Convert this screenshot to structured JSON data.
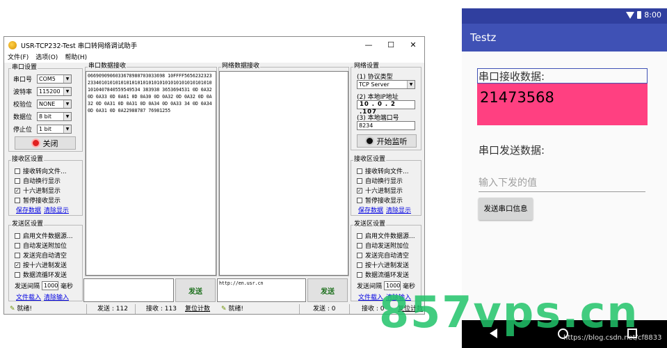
{
  "window": {
    "title": "USR-TCP232-Test 串口转网络调试助手",
    "controls": {
      "minimize": "—",
      "maximize": "☐",
      "close": "✕"
    }
  },
  "menu": [
    "文件(F)",
    "选项(O)",
    "帮助(H)"
  ],
  "serial_settings": {
    "title": "串口设置",
    "port_label": "串口号",
    "port_value": "COM5",
    "baud_label": "波特率",
    "baud_value": "115200",
    "parity_label": "校验位",
    "parity_value": "NONE",
    "databits_label": "数据位",
    "databits_value": "8 bit",
    "stopbits_label": "停止位",
    "stopbits_value": "1 bit",
    "close_button": "关闭"
  },
  "left_recv_settings": {
    "title": "接收区设置",
    "options": [
      "接收转向文件...",
      "自动换行显示",
      "十六进制显示",
      "暂停接收显示"
    ],
    "checked": [
      false,
      false,
      true,
      false
    ],
    "save_link": "保存数据",
    "clear_link": "清除显示"
  },
  "left_send_settings": {
    "title": "发送区设置",
    "options": [
      "启用文件数据源...",
      "自动发送附加位",
      "发送完自动清空",
      "按十六进制发送",
      "数据流循环发送"
    ],
    "checked": [
      false,
      false,
      false,
      true,
      false
    ],
    "interval_label": "发送间隔",
    "interval_value": "1000",
    "interval_unit": "毫秒",
    "load_link": "文件载入",
    "clear_link": "清除输入"
  },
  "serial_recv": {
    "title": "串口数据接收",
    "text": "0669090906033678980703033698 10FFFF56562323232334010101010101010101010101010101010101010101010407840559549534 383938 3653694531 0D 0A32 0D 0A33 0D 0A61 0D 0A30 0D 0A32 0D 0A32 0D 0A32 0D 0A31 0D 0A31 0D 0A34 0D 0A33 34 0D 0A34 0D 0A31 0D 0A22988787 76981255"
  },
  "net_recv": {
    "title": "网络数据接收"
  },
  "net_settings": {
    "title": "网络设置",
    "protocol_label": "(1) 协议类型",
    "protocol_value": "TCP Server",
    "ip_label": "(2) 本地IP地址",
    "ip_value": "10 . 0 . 2 .107",
    "port_label": "(3) 本地端口号",
    "port_value": "8234",
    "listen_button": "开始监听"
  },
  "right_recv_settings": {
    "title": "接收区设置",
    "options": [
      "接收转向文件...",
      "自动换行显示",
      "十六进制显示",
      "暂停接收显示"
    ],
    "checked": [
      false,
      false,
      true,
      false
    ],
    "save_link": "保存数据",
    "clear_link": "清除显示"
  },
  "right_send_settings": {
    "title": "发送区设置",
    "options": [
      "启用文件数据源...",
      "自动发送附加位",
      "发送完自动清空",
      "按十六进制发送",
      "数据流循环发送"
    ],
    "checked": [
      false,
      false,
      false,
      false,
      false
    ],
    "interval_label": "发送间隔",
    "interval_value": "1000",
    "interval_unit": "毫秒",
    "load_link": "文件载入",
    "clear_link": "清除输入"
  },
  "serial_send": {
    "value": "",
    "button": "发送"
  },
  "net_send": {
    "value": "http://en.usr.cn",
    "button": "发送"
  },
  "statusbar": {
    "left_ready": "就绪!",
    "left_sent": "发送 : 112",
    "left_recv": "接收 : 113",
    "left_reset": "复位计数",
    "right_ready": "就绪!",
    "right_sent": "发送 : 0",
    "right_recv": "接收 : 0",
    "right_reset": "复位计数"
  },
  "android": {
    "time": "8:00",
    "app_title": "Testz",
    "recv_label": "串口接收数据:",
    "recv_value": "21473568",
    "send_label": "串口发送数据:",
    "send_placeholder": "输入下发的值",
    "send_button": "发送串口信息",
    "colors": {
      "statusbar": "#303f9f",
      "appbar": "#3f51b5",
      "accent": "#ff4081"
    }
  },
  "watermark": "857vps.cn",
  "credit": "https://blog.csdn.net/cf8833"
}
